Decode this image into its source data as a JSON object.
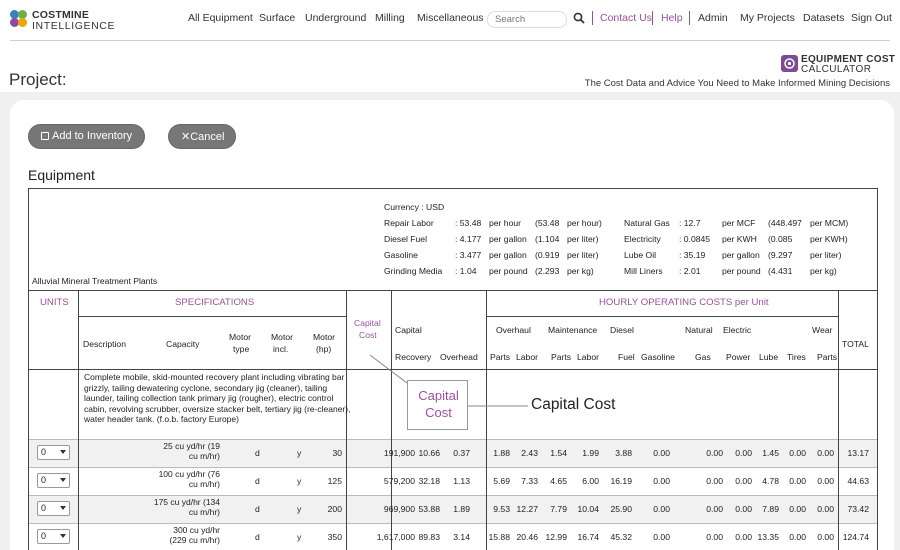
{
  "nav": {
    "logo_line1": "COSTMINE",
    "logo_line2": "INTELLIGENCE",
    "links": [
      "All Equipment",
      "Surface",
      "Underground",
      "Milling",
      "Miscellaneous"
    ],
    "search_placeholder": "Search",
    "contact": "Contact Us",
    "help": "Help",
    "admin": "Admin",
    "my_projects": "My Projects",
    "datasets": "Datasets",
    "sign_out": "Sign Out",
    "accent_color": "#9b4f9f"
  },
  "header": {
    "project_title": "Project:",
    "badge_line1": "EQUIPMENT COST",
    "badge_line2": "CALCULATOR",
    "tagline": "The Cost Data and Advice You Need to Make Informed Mining Decisions"
  },
  "actions": {
    "add_label": "Add to Inventory",
    "cancel_label": "Cancel"
  },
  "section_title": "Equipment",
  "category": "Alluvial Mineral Treatment Plants",
  "currency": {
    "label": "Currency :",
    "value": "USD",
    "left": [
      {
        "name": "Repair Labor",
        "value": ": 53.48",
        "unit": "per hour",
        "alt": "(53.48",
        "alt_unit": "per hour)"
      },
      {
        "name": "Diesel Fuel",
        "value": ": 4.177",
        "unit": "per gallon",
        "alt": "(1.104",
        "alt_unit": "per liter)"
      },
      {
        "name": "Gasoline",
        "value": ": 3.477",
        "unit": "per gallon",
        "alt": "(0.919",
        "alt_unit": "per liter)"
      },
      {
        "name": "Grinding Media",
        "value": ": 1.04",
        "unit": "per pound",
        "alt": "(2.293",
        "alt_unit": "per kg)"
      }
    ],
    "right": [
      {
        "name": "Natural Gas",
        "value": ": 12.7",
        "unit": "per MCF",
        "alt": "(448.497",
        "alt_unit": "per MCM)"
      },
      {
        "name": "Electricity",
        "value": ": 0.0845",
        "unit": "per KWH",
        "alt": "(0.085",
        "alt_unit": "per KWH)"
      },
      {
        "name": "Lube Oil",
        "value": ": 35.19",
        "unit": "per gallon",
        "alt": "(9.297",
        "alt_unit": "per liter)"
      },
      {
        "name": "Mill Liners",
        "value": ": 2.01",
        "unit": "per pound",
        "alt": "(4.431",
        "alt_unit": "per kg)"
      }
    ]
  },
  "headers": {
    "units": "UNITS",
    "specifications": "SPECIFICATIONS",
    "capital_cost": [
      "Capital",
      "Cost"
    ],
    "hourly": "HOURLY OPERATING COSTS per Unit",
    "description": "Description",
    "capacity": "Capacity",
    "motor_type": [
      "Motor",
      "type"
    ],
    "motor_incl": [
      "Motor",
      "incl."
    ],
    "motor_hp": [
      "Motor",
      "(hp)"
    ],
    "capital": "Capital",
    "recovery": "Recovery",
    "overhead": "Overhead",
    "overhaul": "Overhaul",
    "maintenance": "Maintenance",
    "diesel": "Diesel",
    "natural": "Natural",
    "electric": "Electric",
    "wear": "Wear",
    "parts": "Parts",
    "labor": "Labor",
    "fuel": "Fuel",
    "gasoline": "Gasoline",
    "gas": "Gas",
    "power": "Power",
    "lube": "Lube",
    "tires": "Tires",
    "total": "TOTAL"
  },
  "description": "Complete mobile, skid-mounted recovery plant including vibrating bar grizzly, tailing dewatering cyclone, secondary jig (cleaner), tailing launder, tailing collection tank primary jig (rougher), electric control cabin, revolving scrubber, oversize stacker belt, tertiary jig (re-cleaner), water header tank. (f.o.b. factory Europe)",
  "rows": [
    {
      "qty": "0",
      "capacity": [
        "25 cu yd/hr (19",
        "cu m/hr)"
      ],
      "motor_type": "d",
      "motor_incl": "y",
      "hp": "30",
      "capital_cost": "191,900",
      "recovery": "10.66",
      "overhead": "0.37",
      "oh_parts": "1.88",
      "oh_labor": "2.43",
      "m_parts": "1.54",
      "m_labor": "1.99",
      "diesel": "3.88",
      "gasoline": "0.00",
      "natgas": "0.00",
      "power": "0.00",
      "lube": "1.45",
      "tires": "0.00",
      "wear": "0.00",
      "total": "13.17"
    },
    {
      "qty": "0",
      "capacity": [
        "100 cu yd/hr (76",
        "cu m/hr)"
      ],
      "motor_type": "d",
      "motor_incl": "y",
      "hp": "125",
      "capital_cost": "579,200",
      "recovery": "32.18",
      "overhead": "1.13",
      "oh_parts": "5.69",
      "oh_labor": "7.33",
      "m_parts": "4.65",
      "m_labor": "6.00",
      "diesel": "16.19",
      "gasoline": "0.00",
      "natgas": "0.00",
      "power": "0.00",
      "lube": "4.78",
      "tires": "0.00",
      "wear": "0.00",
      "total": "44.63"
    },
    {
      "qty": "0",
      "capacity": [
        "175 cu yd/hr (134",
        "cu m/hr)"
      ],
      "motor_type": "d",
      "motor_incl": "y",
      "hp": "200",
      "capital_cost": "969,900",
      "recovery": "53.88",
      "overhead": "1.89",
      "oh_parts": "9.53",
      "oh_labor": "12.27",
      "m_parts": "7.79",
      "m_labor": "10.04",
      "diesel": "25.90",
      "gasoline": "0.00",
      "natgas": "0.00",
      "power": "0.00",
      "lube": "7.89",
      "tires": "0.00",
      "wear": "0.00",
      "total": "73.42"
    },
    {
      "qty": "0",
      "capacity": [
        "300 cu yd/hr",
        "(229 cu m/hr)"
      ],
      "motor_type": "d",
      "motor_incl": "y",
      "hp": "350",
      "capital_cost": "1,617,000",
      "recovery": "89.83",
      "overhead": "3.14",
      "oh_parts": "15.88",
      "oh_labor": "20.46",
      "m_parts": "12.99",
      "m_labor": "16.74",
      "diesel": "45.32",
      "gasoline": "0.00",
      "natgas": "0.00",
      "power": "0.00",
      "lube": "13.35",
      "tires": "0.00",
      "wear": "0.00",
      "total": "124.74"
    }
  ],
  "callout": {
    "box_line1": "Capital",
    "box_line2": "Cost",
    "label": "Capital Cost"
  }
}
